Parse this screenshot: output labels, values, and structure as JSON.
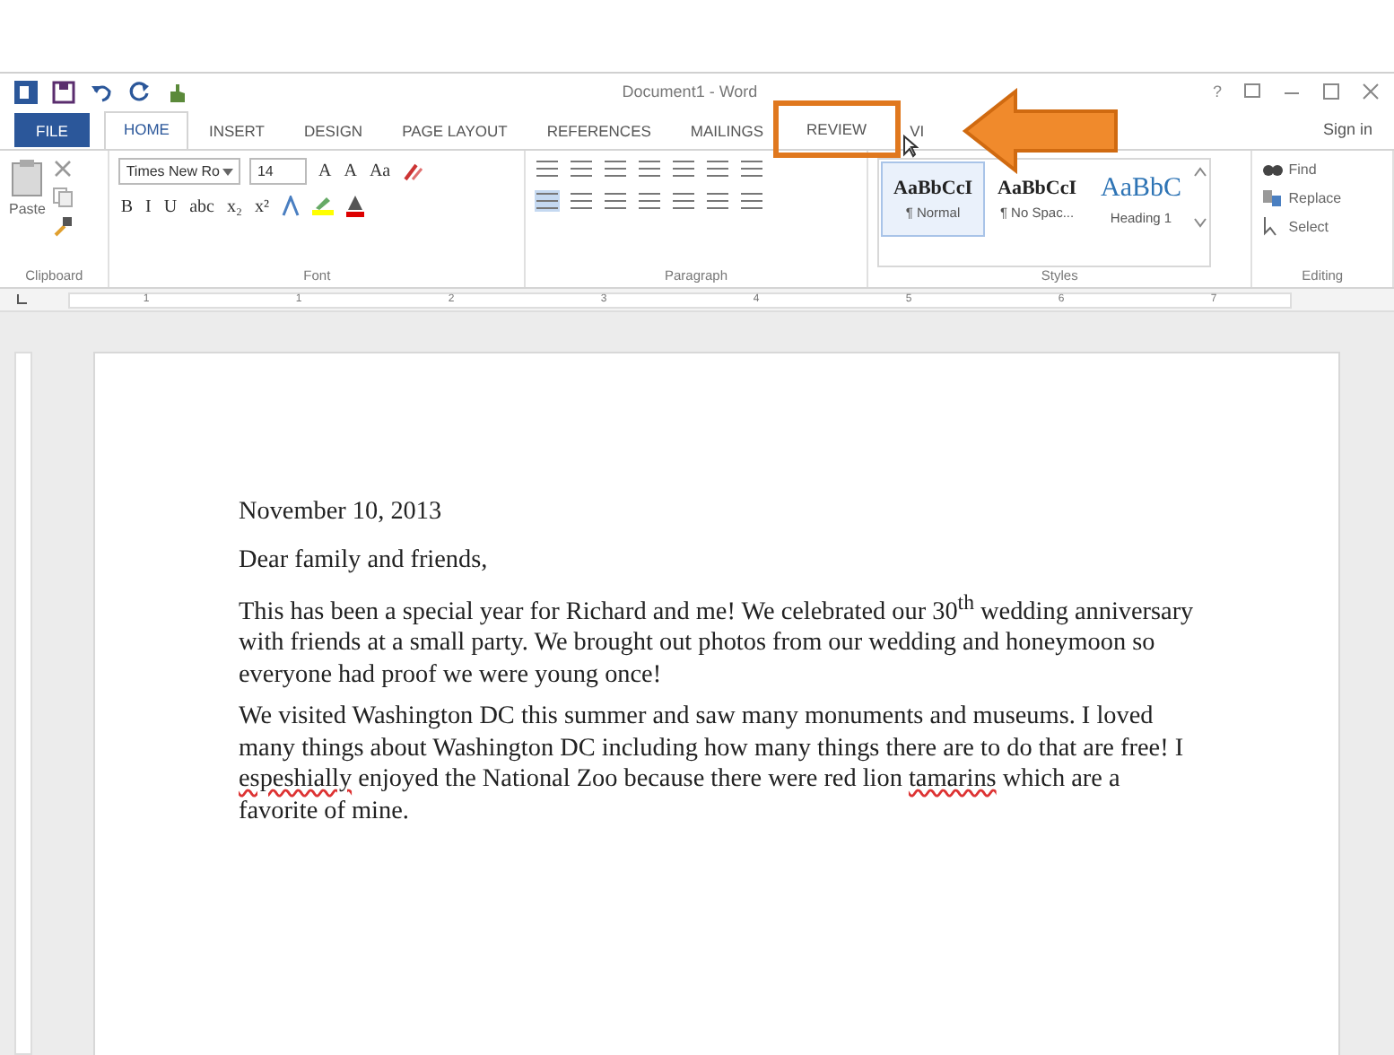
{
  "window": {
    "title": "Document1 - Word",
    "help": "?"
  },
  "tabs": [
    {
      "label": "FILE",
      "kind": "file",
      "selected": false,
      "highlighted": false
    },
    {
      "label": "HOME",
      "kind": "tab",
      "selected": true,
      "highlighted": false
    },
    {
      "label": "INSERT",
      "kind": "tab",
      "selected": false,
      "highlighted": false
    },
    {
      "label": "DESIGN",
      "kind": "tab",
      "selected": false,
      "highlighted": false
    },
    {
      "label": "PAGE LAYOUT",
      "kind": "tab",
      "selected": false,
      "highlighted": false
    },
    {
      "label": "REFERENCES",
      "kind": "tab",
      "selected": false,
      "highlighted": false
    },
    {
      "label": "MAILINGS",
      "kind": "tab",
      "selected": false,
      "highlighted": false
    },
    {
      "label": "REVIEW",
      "kind": "tab",
      "selected": false,
      "highlighted": true
    },
    {
      "label": "VI",
      "kind": "tab",
      "selected": false,
      "highlighted": false
    }
  ],
  "sign_in": "Sign in",
  "ribbon": {
    "paste": "Paste",
    "font_name": "Times New Ro",
    "font_size": "14",
    "font_buttons": [
      "A",
      "A",
      "Aa"
    ],
    "format_buttons": [
      "B",
      "I",
      "U",
      "abc",
      "x₂",
      "x²"
    ],
    "styles": [
      {
        "sample": "AaBbCcI",
        "name": "¶ Normal",
        "kind": "body",
        "selected": true
      },
      {
        "sample": "AaBbCcI",
        "name": "¶ No Spac...",
        "kind": "body",
        "selected": false
      },
      {
        "sample": "AaBbC",
        "name": "Heading 1",
        "kind": "heading",
        "selected": false
      }
    ],
    "editing": [
      "Find",
      "Replace",
      "Select"
    ],
    "groups": [
      "Clipboard",
      "Font",
      "Paragraph",
      "Styles",
      "Editing"
    ]
  },
  "ruler": {
    "marks": [
      "1",
      "1",
      "2",
      "3",
      "4",
      "5",
      "6",
      "7"
    ]
  },
  "document": {
    "paragraphs": [
      [
        {
          "text": "November 10, 2013",
          "misspelled": false
        }
      ],
      [
        {
          "text": "Dear family and friends,",
          "misspelled": false
        }
      ],
      [
        {
          "text": "This has been a special year for Richard and me! We celebrated our 30$^{th}$ wedding anniversary with friends at a small party.  We brought out photos from our wedding and honeymoon so everyone had proof we were young once!",
          "misspelled": false
        }
      ],
      [
        {
          "text": "We visited Washington DC this summer and saw many monuments and museums. I loved many things about Washington DC including how many things there are to do that are free!  I ",
          "misspelled": false
        },
        {
          "text": "espeshially",
          "misspelled": true
        },
        {
          "text": " enjoyed the National Zoo because there were red lion ",
          "misspelled": false
        },
        {
          "text": "tamarins",
          "misspelled": true
        },
        {
          "text": " which are a favorite of mine.",
          "misspelled": false
        }
      ]
    ]
  }
}
